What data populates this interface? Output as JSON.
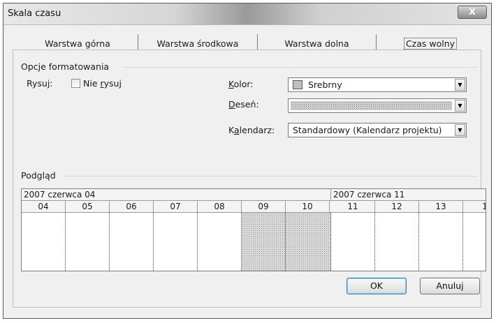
{
  "window": {
    "title": "Skala czasu",
    "close_label": "X"
  },
  "tabs": [
    {
      "label": "Warstwa górna"
    },
    {
      "label": "Warstwa środkowa"
    },
    {
      "label": "Warstwa dolna"
    },
    {
      "label": "Czas wolny",
      "selected": true
    }
  ],
  "formatting": {
    "group_label": "Opcje formatowania",
    "draw_label": "Rysuj:",
    "no_draw_label_pre": "Nie ",
    "no_draw_label_underlined": "r",
    "no_draw_label_post": "ysuj",
    "no_draw_checked": false,
    "color_label_underlined": "K",
    "color_label_rest": "olor:",
    "color_value": "Srebrny",
    "color_swatch": "#c0c0c0",
    "pattern_label_underlined": "D",
    "pattern_label_rest": "eseń:",
    "calendar_label_pre": "K",
    "calendar_label_underlined": "a",
    "calendar_label_rest": "lendarz:",
    "calendar_value": "Standardowy (Kalendarz projektu)"
  },
  "preview": {
    "group_label": "Podgląd",
    "weeks": [
      "2007 czerwca 04",
      "2007 czerwca 11"
    ],
    "days": [
      "04",
      "05",
      "06",
      "07",
      "08",
      "09",
      "10",
      "11",
      "12",
      "13",
      "1"
    ],
    "nonworking_days": [
      "09",
      "10"
    ]
  },
  "buttons": {
    "ok": "OK",
    "cancel": "Anuluj"
  },
  "icons": {
    "dropdown": "chevron-down-icon",
    "close": "close-icon"
  }
}
